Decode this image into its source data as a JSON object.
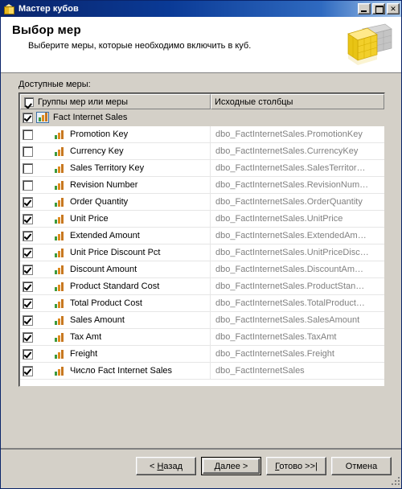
{
  "window": {
    "title": "Мастер кубов",
    "icon": "cube-icon",
    "controls": {
      "minimize": "_",
      "maximize": "□",
      "close": "✕"
    }
  },
  "banner": {
    "title": "Выбор мер",
    "subtitle": "Выберите меры, которые необходимо включить в куб.",
    "icon": "cube-graphic"
  },
  "list": {
    "label_prefix": "Д",
    "label_rest": "оступные меры:",
    "label_full": "Доступные меры:",
    "header": {
      "checkbox_checked": true,
      "col1": "Группы мер или меры",
      "col2": "Исходные столбцы"
    },
    "rows": [
      {
        "label": "Fact Internet Sales",
        "source": "",
        "checked": true,
        "group": true,
        "selected": true
      },
      {
        "label": "Promotion Key",
        "source": "dbo_FactInternetSales.PromotionKey",
        "checked": false,
        "group": false,
        "selected": false
      },
      {
        "label": "Currency Key",
        "source": "dbo_FactInternetSales.CurrencyKey",
        "checked": false,
        "group": false,
        "selected": false
      },
      {
        "label": "Sales Territory Key",
        "source": "dbo_FactInternetSales.SalesTerritor…",
        "checked": false,
        "group": false,
        "selected": false
      },
      {
        "label": "Revision Number",
        "source": "dbo_FactInternetSales.RevisionNum…",
        "checked": false,
        "group": false,
        "selected": false
      },
      {
        "label": "Order Quantity",
        "source": "dbo_FactInternetSales.OrderQuantity",
        "checked": true,
        "group": false,
        "selected": false
      },
      {
        "label": "Unit Price",
        "source": "dbo_FactInternetSales.UnitPrice",
        "checked": true,
        "group": false,
        "selected": false
      },
      {
        "label": "Extended Amount",
        "source": "dbo_FactInternetSales.ExtendedAm…",
        "checked": true,
        "group": false,
        "selected": false
      },
      {
        "label": "Unit Price Discount Pct",
        "source": "dbo_FactInternetSales.UnitPriceDisc…",
        "checked": true,
        "group": false,
        "selected": false
      },
      {
        "label": "Discount Amount",
        "source": "dbo_FactInternetSales.DiscountAm…",
        "checked": true,
        "group": false,
        "selected": false
      },
      {
        "label": "Product Standard Cost",
        "source": "dbo_FactInternetSales.ProductStan…",
        "checked": true,
        "group": false,
        "selected": false
      },
      {
        "label": "Total Product Cost",
        "source": "dbo_FactInternetSales.TotalProduct…",
        "checked": true,
        "group": false,
        "selected": false
      },
      {
        "label": "Sales Amount",
        "source": "dbo_FactInternetSales.SalesAmount",
        "checked": true,
        "group": false,
        "selected": false
      },
      {
        "label": "Tax Amt",
        "source": "dbo_FactInternetSales.TaxAmt",
        "checked": true,
        "group": false,
        "selected": false
      },
      {
        "label": "Freight",
        "source": "dbo_FactInternetSales.Freight",
        "checked": true,
        "group": false,
        "selected": false
      },
      {
        "label": "Число Fact Internet Sales",
        "source": "dbo_FactInternetSales",
        "checked": true,
        "group": false,
        "selected": false
      }
    ]
  },
  "footer": {
    "buttons": [
      {
        "name": "back",
        "pre": "< ",
        "accel": "Н",
        "post": "азад",
        "default": false
      },
      {
        "name": "next",
        "pre": "",
        "accel": "Д",
        "post": "алее >",
        "default": true
      },
      {
        "name": "finish",
        "pre": "",
        "accel": "Г",
        "post": "отово >>|",
        "default": false
      },
      {
        "name": "cancel",
        "pre": "",
        "accel": "",
        "post": "Отмена",
        "default": false
      }
    ]
  },
  "colors": {
    "window_face": "#d4d0c8",
    "title_active": "#0a246a",
    "selection": "#d4d0c8",
    "source_text": "#808080",
    "icon_green": "#3c9a3c",
    "icon_orange": "#e08a1e",
    "icon_brown": "#c87820"
  }
}
